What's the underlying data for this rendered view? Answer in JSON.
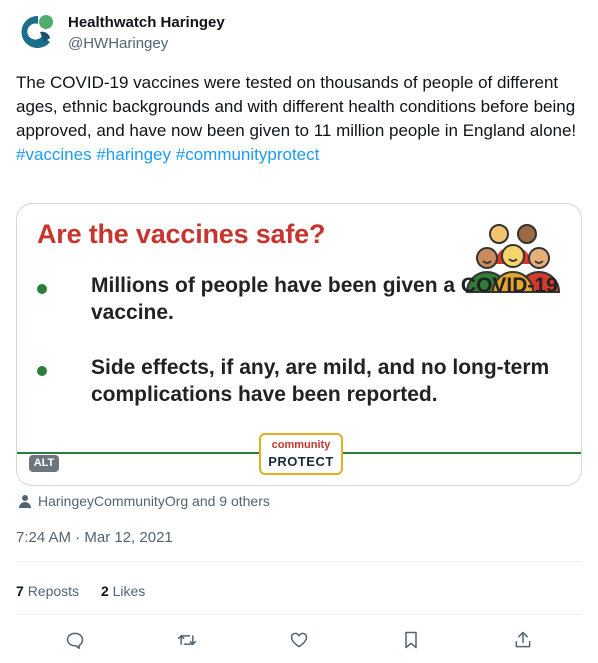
{
  "author": {
    "name": "Healthwatch Haringey",
    "handle": "@HWHaringey",
    "avatar_icon": "healthwatch-logo-icon"
  },
  "tweet": {
    "text": "The COVID-19 vaccines were tested on thousands of people of different ages, ethnic backgrounds and with different health conditions before being approved, and have now been given to 11 million people in England alone!",
    "hashtags": [
      "#vaccines",
      "#haringey",
      "#communityprotect"
    ]
  },
  "media": {
    "title": "Are the vaccines safe?",
    "bullets": [
      "Millions of people have been given a COVID-19 vaccine.",
      "Side effects, if any, are mild, and no long-term complications have been reported."
    ],
    "logo_top": "community",
    "logo_bottom": "PROTECT",
    "alt_label": "ALT",
    "colors": {
      "title": "#c8352e",
      "bullet": "#2e7d3a"
    }
  },
  "liked_by": "HaringeyCommunityOrg and 9 others",
  "timestamp": "7:24 AM · Mar 12, 2021",
  "stats": {
    "reposts_count": "7",
    "reposts_label": "Reposts",
    "likes_count": "2",
    "likes_label": "Likes"
  },
  "actions": [
    "reply-icon",
    "repost-icon",
    "like-icon",
    "bookmark-icon",
    "share-icon"
  ],
  "accent_color": "#1d9bf0"
}
